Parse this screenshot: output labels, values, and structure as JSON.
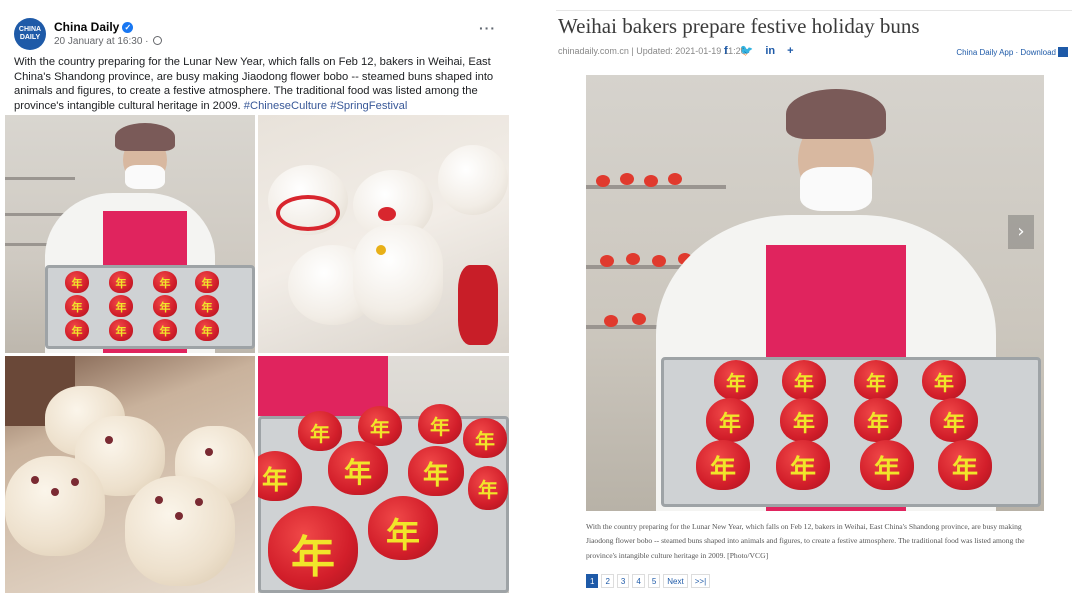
{
  "facebook_post": {
    "page_name": "China Daily",
    "avatar_text": "CHINA DAILY",
    "date": "20 January at 16:30 ·",
    "body": "With the country preparing for the Lunar New Year, which falls on Feb 12, bakers in Weihai, East China's Shandong province, are busy making Jiaodong flower bobo -- steamed buns shaped into animals and figures, to create a festive atmosphere. The traditional food was listed among the province's intangible cultural heritage in 2009.",
    "hashtags": [
      "#ChineseCulture",
      "#SpringFestival"
    ],
    "more_label": "···"
  },
  "article": {
    "title": "Weihai bakers prepare festive holiday buns",
    "meta": "chinadaily.com.cn | Updated: 2021-01-19 11:20",
    "share_icons": [
      "f",
      "🐦",
      "in",
      "+"
    ],
    "app_link": "China Daily App · Download",
    "caption": "With the country preparing for the Lunar New Year, which falls on Feb 12, bakers in Weihai, East China's Shandong province, are busy making Jiaodong flower bobo -- steamed buns shaped into animals and figures, to create a festive atmosphere. The traditional food was listed among the province's intangible culture heritage in 2009. [Photo/VCG]",
    "pagination": [
      "1",
      "2",
      "3",
      "4",
      "5",
      "Next",
      ">>|"
    ],
    "active_page": "1",
    "next_arrow": "›"
  },
  "colors": {
    "facebook_link": "#385898",
    "chinadaily_blue": "#1e5aa8",
    "bun_red": "#d21e2a",
    "bun_yellow": "#f1e52a",
    "apron_pink": "#e0245e"
  }
}
